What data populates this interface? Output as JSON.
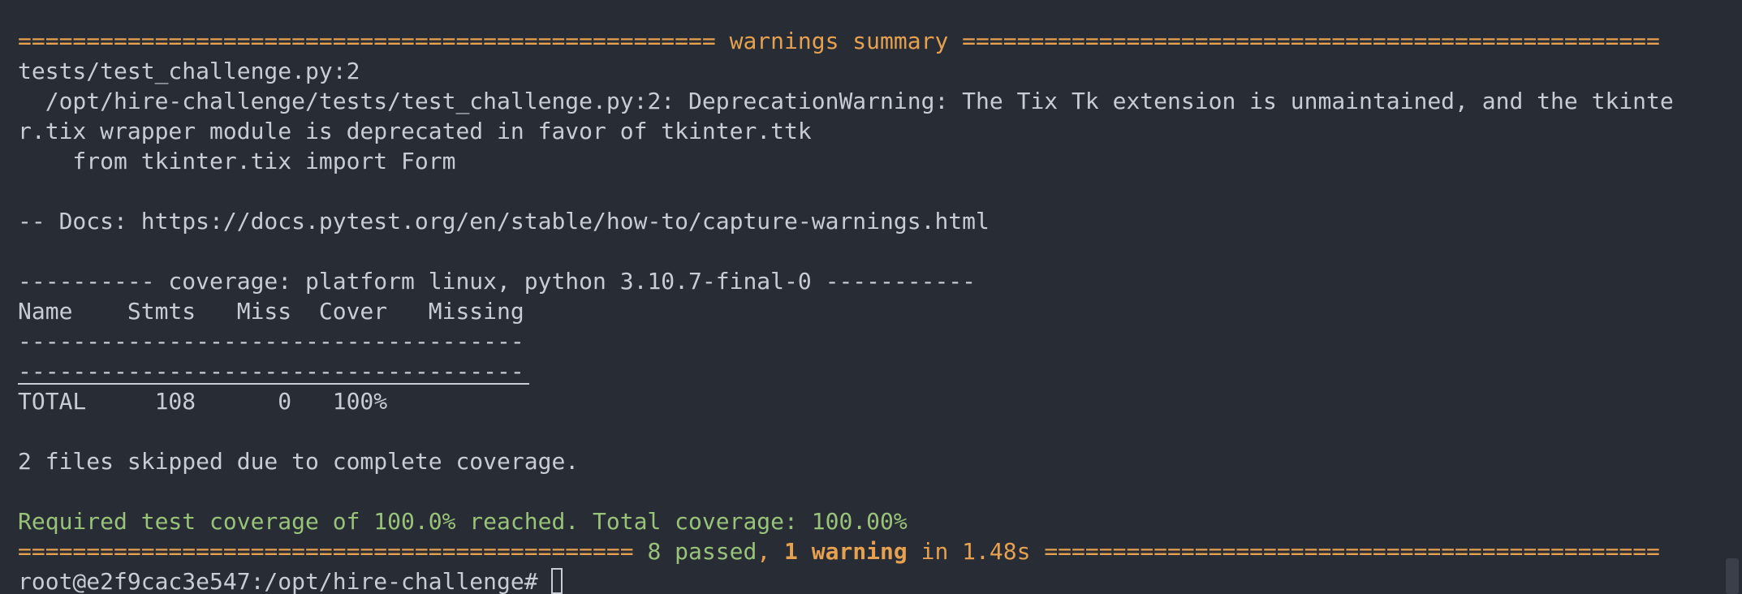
{
  "terminal": {
    "warnings_header": "=================================================== warnings summary ===================================================",
    "warn_file": "tests/test_challenge.py:2",
    "warn_msg_1": "  /opt/hire-challenge/tests/test_challenge.py:2: DeprecationWarning: The Tix Tk extension is unmaintained, and the tkinte",
    "warn_msg_2": "r.tix wrapper module is deprecated in favor of tkinter.ttk",
    "warn_code": "    from tkinter.tix import Form",
    "docs_line": "-- Docs: https://docs.pytest.org/en/stable/how-to/capture-warnings.html",
    "coverage_header": "---------- coverage: platform linux, python 3.10.7-final-0 -----------",
    "table_header": "Name    Stmts   Miss  Cover   Missing",
    "table_sep_1": "-------------------------------------",
    "table_sep_2": "-------------------------------------",
    "total_row": "TOTAL     108      0   100%",
    "skipped_line": "2 files skipped due to complete coverage.",
    "required_line": "Required test coverage of 100.0% reached. Total coverage: 100.00%",
    "summary_prefix": "============================================= ",
    "summary_passed": "8 passed",
    "summary_comma": ", ",
    "summary_warning": "1 warning",
    "summary_suffix": " in 1.48s =============================================",
    "prompt": "root@e2f9cac3e547:/opt/hire-challenge# "
  },
  "colors": {
    "background": "#282c34",
    "text": "#c8ccd4",
    "orange": "#e5a050",
    "green": "#98c379"
  }
}
